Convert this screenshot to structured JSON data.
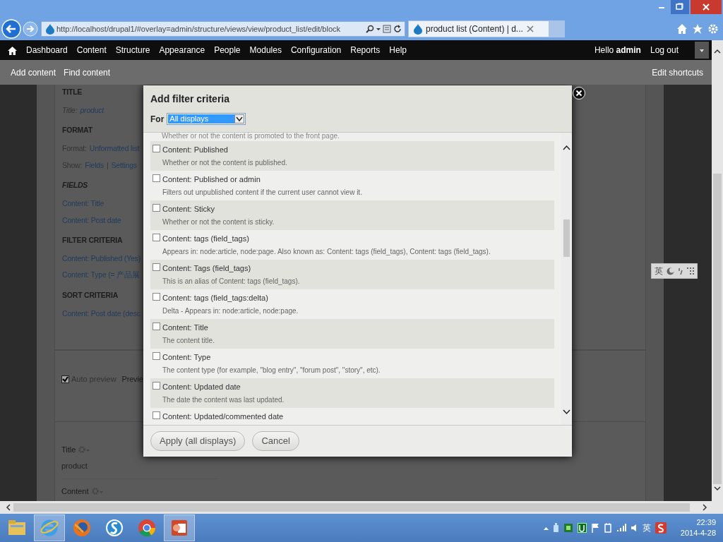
{
  "browser": {
    "url": "http://localhost/drupal1/#overlay=admin/structure/views/view/product_list/edit/block",
    "tab_title": "product list (Content) | d..."
  },
  "toolbar": {
    "items": [
      "Dashboard",
      "Content",
      "Structure",
      "Appearance",
      "People",
      "Modules",
      "Configuration",
      "Reports",
      "Help"
    ],
    "greeting": "Hello **admin**",
    "logout": "Log out"
  },
  "shortcuts": {
    "items": [
      "Add content",
      "Find content"
    ],
    "edit": "Edit shortcuts"
  },
  "view_settings": {
    "sections": [
      {
        "heading": "TITLE",
        "italic": false,
        "lines": [
          [
            {
              "kind": "label",
              "text": "Title:"
            },
            {
              "kind": "value",
              "text": "product"
            }
          ]
        ]
      },
      {
        "heading": "FORMAT",
        "italic": false,
        "lines": [
          [
            {
              "kind": "label",
              "text": "Format:"
            },
            {
              "kind": "link",
              "text": "Unformatted list"
            }
          ],
          [
            {
              "kind": "label",
              "text": "Show:"
            },
            {
              "kind": "link",
              "text": "Fields"
            },
            {
              "kind": "label",
              "text": "|"
            },
            {
              "kind": "link",
              "text": "Settings"
            }
          ]
        ]
      },
      {
        "heading": "FIELDS",
        "italic": true,
        "lines": [
          [
            {
              "kind": "link",
              "text": "Content: Title"
            }
          ],
          [
            {
              "kind": "link",
              "text": "Content: Post date"
            }
          ]
        ]
      },
      {
        "heading": "FILTER CRITERIA",
        "italic": false,
        "lines": [
          [
            {
              "kind": "link",
              "text": "Content: Published (Yes)"
            }
          ],
          [
            {
              "kind": "link",
              "text": "Content: Type (= 产品展"
            }
          ]
        ]
      },
      {
        "heading": "SORT CRITERIA",
        "italic": false,
        "lines": [
          [
            {
              "kind": "link",
              "text": "Content: Post date (desc"
            }
          ]
        ]
      }
    ]
  },
  "preview": {
    "auto_preview": {
      "label": "Auto preview",
      "checked": true
    },
    "preview_button": "Previe",
    "fields": [
      {
        "label": "Title",
        "value": "product"
      },
      {
        "label": "Content"
      }
    ]
  },
  "dialog": {
    "title": "Add filter criteria",
    "for_label": "For",
    "for_value": "All displays",
    "top_description": "Whether or not the content is promoted to the front page.",
    "items": [
      {
        "title": "Content: Published",
        "description": "Whether or not the content is published.",
        "checked": false
      },
      {
        "title": "Content: Published or admin",
        "description": "Filters out unpublished content if the current user cannot view it.",
        "checked": false
      },
      {
        "title": "Content: Sticky",
        "description": "Whether or not the content is sticky.",
        "checked": false
      },
      {
        "title": "Content: tags (field_tags)",
        "description": "Appears in: node:article, node:page. Also known as: Content: tags (field_tags), Content: tags (field_tags).",
        "checked": false
      },
      {
        "title": "Content: Tags (field_tags)",
        "description": "This is an alias of Content: tags (field_tags).",
        "checked": false
      },
      {
        "title": "Content: tags (field_tags:delta)",
        "description": "Delta - Appears in: node:article, node:page.",
        "checked": false
      },
      {
        "title": "Content: Title",
        "description": "The content title.",
        "checked": false
      },
      {
        "title": "Content: Type",
        "description": "The content type (for example, \"blog entry\", \"forum post\", \"story\", etc).",
        "checked": false
      },
      {
        "title": "Content: Updated date",
        "description": "The date the content was last updated.",
        "checked": false
      },
      {
        "title": "Content: Updated/commented date",
        "checked": false
      }
    ],
    "buttons": [
      "Apply (all displays)",
      "Cancel"
    ]
  },
  "ime_bar": {
    "mode": "英"
  },
  "taskbar": {
    "apps": [
      {
        "kind": "folder",
        "active": false
      },
      {
        "kind": "ie",
        "active": true
      },
      {
        "kind": "firefox",
        "active": false
      },
      {
        "kind": "s-app",
        "active": false
      },
      {
        "kind": "chrome",
        "active": false
      },
      {
        "kind": "slides",
        "active": true
      }
    ],
    "input_mode": "英",
    "time": "22:39",
    "date": "2014-4-28"
  }
}
